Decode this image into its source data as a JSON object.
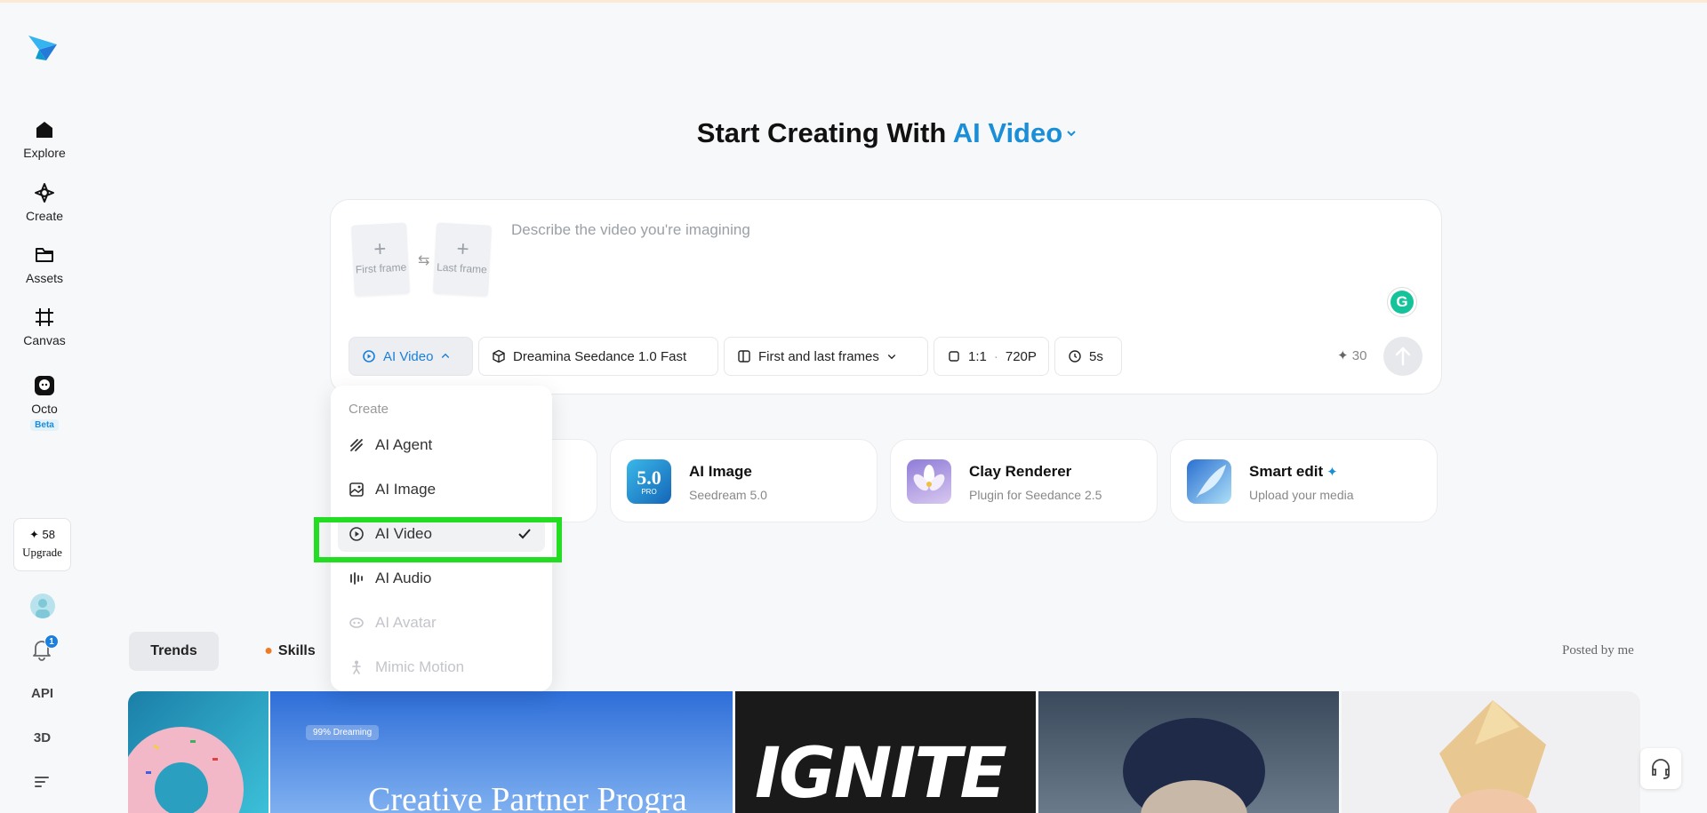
{
  "sidebar": {
    "items": [
      {
        "label": "Explore",
        "icon": "home-icon"
      },
      {
        "label": "Create",
        "icon": "sparkle-diamond-icon"
      },
      {
        "label": "Assets",
        "icon": "folder-icon"
      },
      {
        "label": "Canvas",
        "icon": "crop-icon"
      },
      {
        "label": "Octo",
        "icon": "octo-icon"
      }
    ],
    "octo_badge": "Beta",
    "credits": "✦ 58",
    "upgrade": "Upgrade",
    "notifications": "1",
    "api": "API",
    "three_d": "3D"
  },
  "heading": {
    "prefix": "Start Creating With ",
    "accent": "AI Video"
  },
  "prompt_card": {
    "first_frame": "First frame",
    "last_frame": "Last frame",
    "placeholder": "Describe the video you're imagining",
    "grammarly": "G",
    "mode": "AI Video",
    "model": "Dreamina Seedance 1.0 Fast",
    "frames_mode": "First and last frames",
    "ratio": "1:1",
    "resolution": "720P",
    "duration": "5s",
    "cost": "30"
  },
  "feature_cards": [
    {
      "title": "AI Image",
      "subtitle": "Seedream 5.0",
      "thumb_text": "5.0",
      "thumb_sub": "PRO"
    },
    {
      "title": "Clay Renderer",
      "subtitle": "Plugin for Seedance 2.5"
    },
    {
      "title": "Smart edit",
      "subtitle": "Upload your media"
    }
  ],
  "tabs": [
    {
      "label": "Trends"
    },
    {
      "label": "Skills"
    }
  ],
  "posted_by": "Posted by me",
  "gallery": {
    "banner_badge": "99% Dreaming",
    "banner_text": "Creative Partner Progra",
    "ignite_text": "IGNITE"
  },
  "dropdown": {
    "header": "Create",
    "items": [
      {
        "label": "AI Agent",
        "state": "enabled"
      },
      {
        "label": "AI Image",
        "state": "enabled"
      },
      {
        "label": "AI Video",
        "state": "selected"
      },
      {
        "label": "AI Audio",
        "state": "enabled"
      },
      {
        "label": "AI Avatar",
        "state": "disabled"
      },
      {
        "label": "Mimic Motion",
        "state": "disabled"
      }
    ]
  },
  "colors": {
    "accent": "#1a8fd8",
    "highlight": "#22dd22"
  }
}
